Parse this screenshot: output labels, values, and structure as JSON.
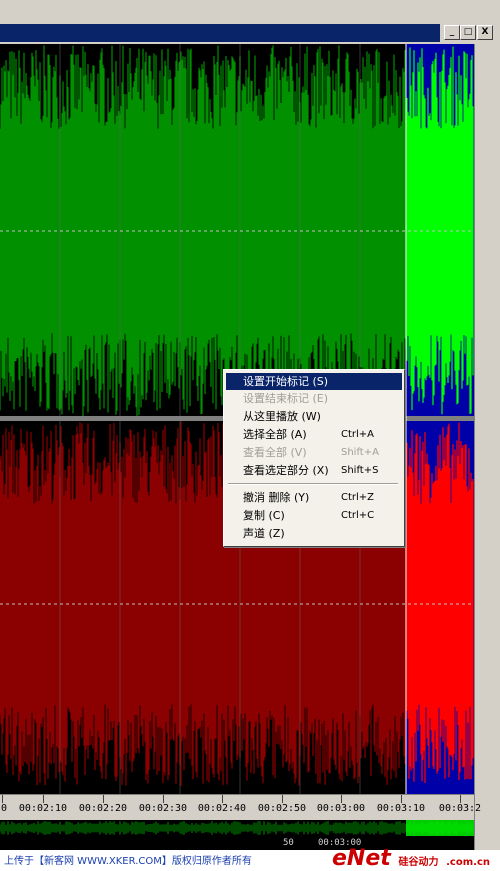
{
  "window": {
    "minimize_glyph": "_",
    "restore_glyph": "□",
    "close_glyph": "X"
  },
  "colors": {
    "upper_wave": "#009000",
    "upper_wave_selected": "#00ff00",
    "lower_wave": "#8b0000",
    "lower_wave_selected": "#ff0000",
    "selection_bg": "#0000a8",
    "menu_highlight": "#0a246a"
  },
  "ruler": {
    "labels": [
      "0",
      "00:02:10",
      "00:02:20",
      "00:02:30",
      "00:02:40",
      "00:02:50",
      "00:03:00",
      "00:03:10",
      "00:03:2"
    ]
  },
  "context_menu": {
    "items": [
      {
        "label": "设置开始标记 (S)",
        "shortcut": "",
        "state": "highlighted"
      },
      {
        "label": "设置结束标记 (E)",
        "shortcut": "",
        "state": "disabled"
      },
      {
        "label": "从这里播放 (W)",
        "shortcut": "",
        "state": "normal"
      },
      {
        "label": "选择全部 (A)",
        "shortcut": "Ctrl+A",
        "state": "normal"
      },
      {
        "label": "查看全部 (V)",
        "shortcut": "Shift+A",
        "state": "disabled"
      },
      {
        "label": "查看选定部分 (X)",
        "shortcut": "Shift+S",
        "state": "normal"
      },
      {
        "label": "撤消 删除 (Y)",
        "shortcut": "Ctrl+Z",
        "state": "normal"
      },
      {
        "label": "复制 (C)",
        "shortcut": "Ctrl+C",
        "state": "normal"
      },
      {
        "label": "声道 (Z)",
        "shortcut": "",
        "state": "normal"
      }
    ]
  },
  "overview": {
    "time_label": "00:03:00",
    "time_label_partial": "50"
  },
  "footer": {
    "credit": "上传于【新客网 WWW.XKER.COM】版权归原作者所有",
    "logo_main": "eNet",
    "logo_cn": "硅谷动力",
    "logo_sub": ".com.cn"
  }
}
